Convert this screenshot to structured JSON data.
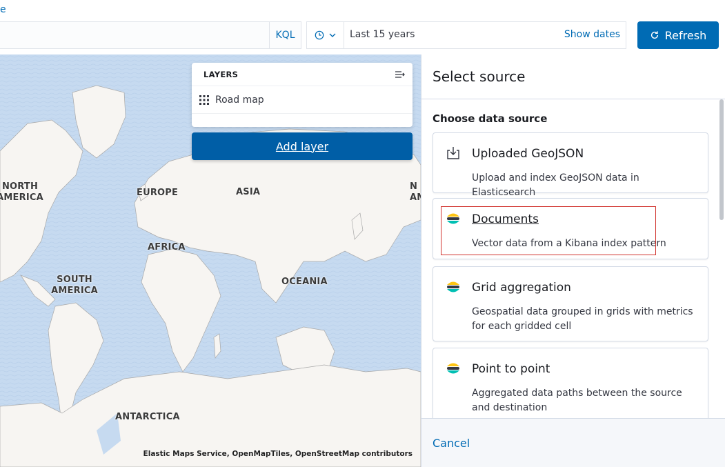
{
  "top_link_fragment": "e",
  "query": {
    "language_label": "KQL"
  },
  "date": {
    "range_label": "Last 15 years",
    "show_dates_label": "Show dates"
  },
  "refresh_label": "Refresh",
  "map": {
    "labels": {
      "north_america": "NORTH\nAMERICA",
      "europe": "EUROPE",
      "asia": "ASIA",
      "africa": "AFRICA",
      "south_america": "SOUTH\nAMERICA",
      "oceania": "OCEANIA",
      "antarctica": "ANTARCTICA",
      "right_edge": "N\nAM"
    },
    "attribution": "Elastic Maps Service, OpenMapTiles, OpenStreetMap contributors",
    "colors": {
      "water": "#c6daf0",
      "land": "#f7f5f2"
    }
  },
  "layers_panel": {
    "title": "LAYERS",
    "layers": [
      {
        "name": "Road map",
        "icon": "grid-icon"
      }
    ],
    "add_layer_label": "Add layer"
  },
  "flyout": {
    "title": "Select source",
    "section_title": "Choose data source",
    "sources": [
      {
        "title": "Uploaded GeoJSON",
        "description": "Upload and index GeoJSON data in Elasticsearch",
        "icon": "import-icon"
      },
      {
        "title": "Documents",
        "description": "Vector data from a Kibana index pattern",
        "icon": "elastic-logo-icon"
      },
      {
        "title": "Grid aggregation",
        "description": "Geospatial data grouped in grids with metrics for each gridded cell",
        "icon": "elastic-logo-icon"
      },
      {
        "title": "Point to point",
        "description": "Aggregated data paths between the source and destination",
        "icon": "elastic-logo-icon"
      }
    ],
    "cancel_label": "Cancel"
  },
  "accent_color": "#006bb4",
  "highlight_color": "#d0302b"
}
